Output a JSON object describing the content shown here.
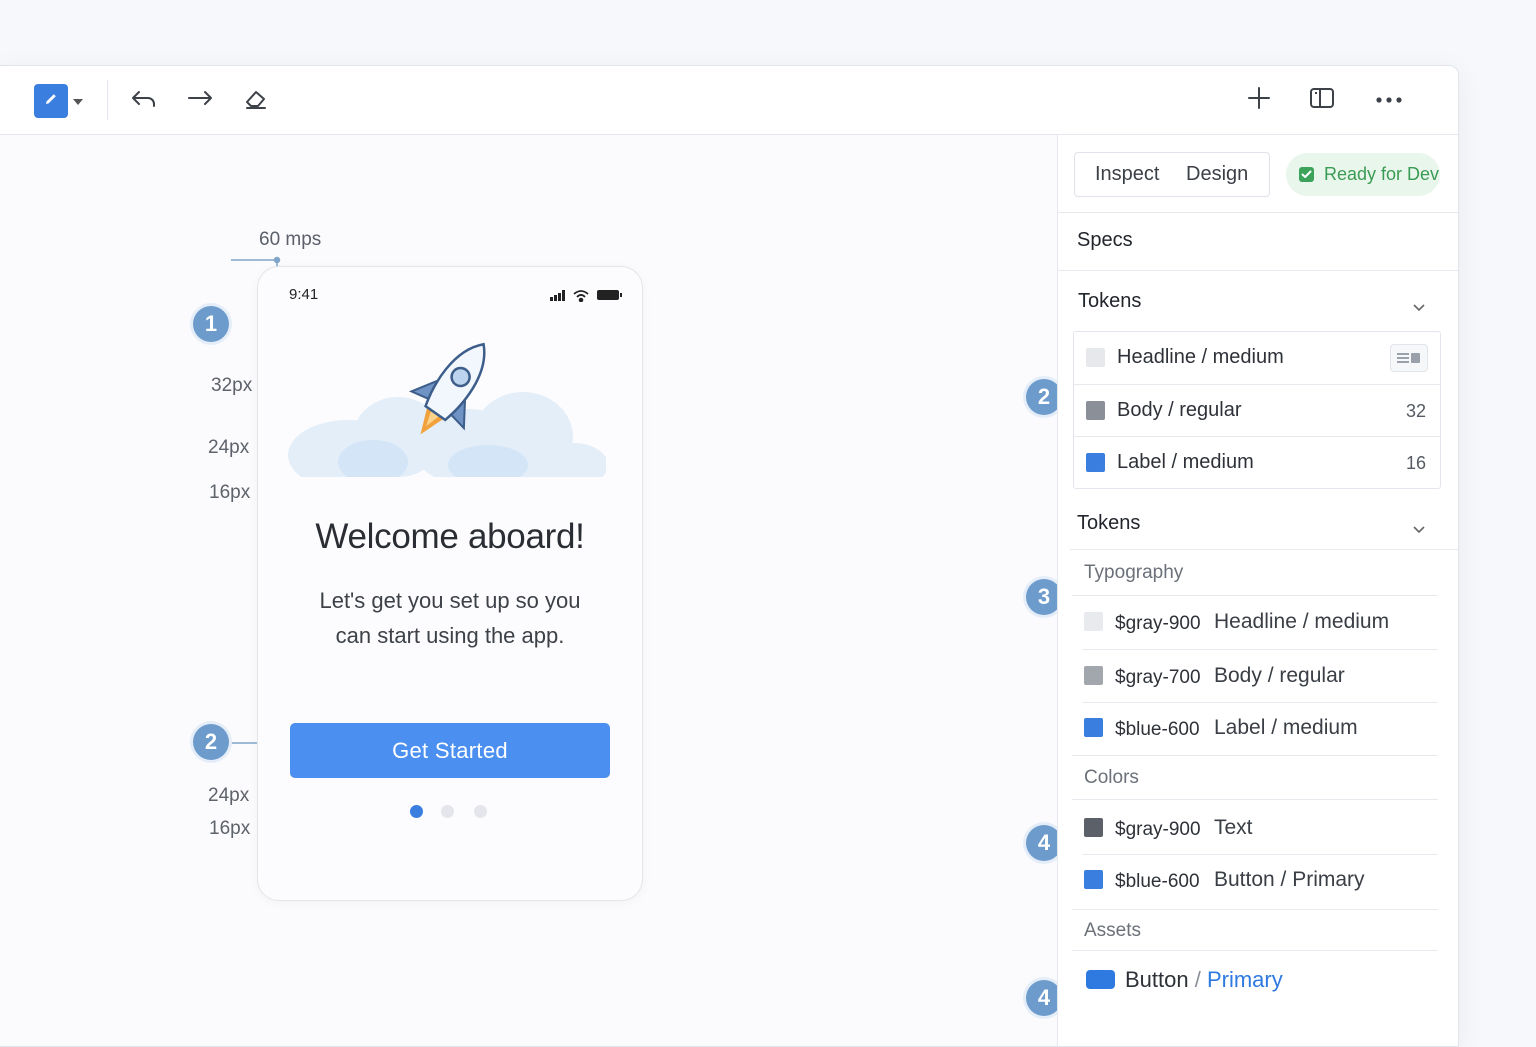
{
  "toolbar": {
    "icons": [
      "pencil-icon",
      "caret-down-icon",
      "undo-icon",
      "redo-icon",
      "eraser-icon",
      "plus-icon",
      "panel-toggle-icon",
      "more-icon"
    ]
  },
  "canvas": {
    "fps_label": "60 mps",
    "annotations": {
      "badge_top": "1",
      "badge_bottom": "2",
      "m_top_1": "32px",
      "m_top_2": "24px",
      "m_top_3": "16px",
      "m_bot_1": "24px",
      "m_bot_2": "16px"
    },
    "phone": {
      "time": "9:41",
      "title": "Welcome aboard!",
      "subtitle_line1": "Let's get you set up so you",
      "subtitle_line2": "can start using the app.",
      "cta_label": "Get Started",
      "pager": {
        "count": 3,
        "active": 1
      }
    }
  },
  "inspector": {
    "tabs": [
      "Inspect",
      "Design"
    ],
    "status": "Ready for Dev",
    "specs_title": "Specs",
    "tokens_section_1": {
      "badge": "2",
      "title": "Tokens",
      "rows": [
        {
          "name": "Headline / medium",
          "value": "",
          "color": "#e7e8eb"
        },
        {
          "name": "Body / regular",
          "value": "32",
          "color": "#8a8f98"
        },
        {
          "name": "Label / medium",
          "value": "16",
          "color": "#3a7fe0"
        }
      ]
    },
    "tokens_section_2": {
      "badge": "3",
      "title": "Tokens",
      "typography_label": "Typography",
      "typography": [
        {
          "var": "$gray-900",
          "name": "Headline / medium",
          "color": "#e9eaed"
        },
        {
          "var": "$gray-700",
          "name": "Body / regular",
          "color": "#a2a6ad"
        },
        {
          "var": "$blue-600",
          "name": "Label / medium",
          "color": "#3a7fe0"
        }
      ],
      "colors_badge": "4",
      "colors_label": "Colors",
      "colors": [
        {
          "var": "$gray-900",
          "name": "Text",
          "color": "#5c6068"
        },
        {
          "var": "$blue-600",
          "name": "Button / Primary",
          "color": "#3a7fe0"
        }
      ],
      "assets_badge": "4",
      "assets_label": "Assets",
      "asset": {
        "name": "Button",
        "sep": " / ",
        "variant": "Primary",
        "color": "#2e7ae0"
      }
    }
  }
}
